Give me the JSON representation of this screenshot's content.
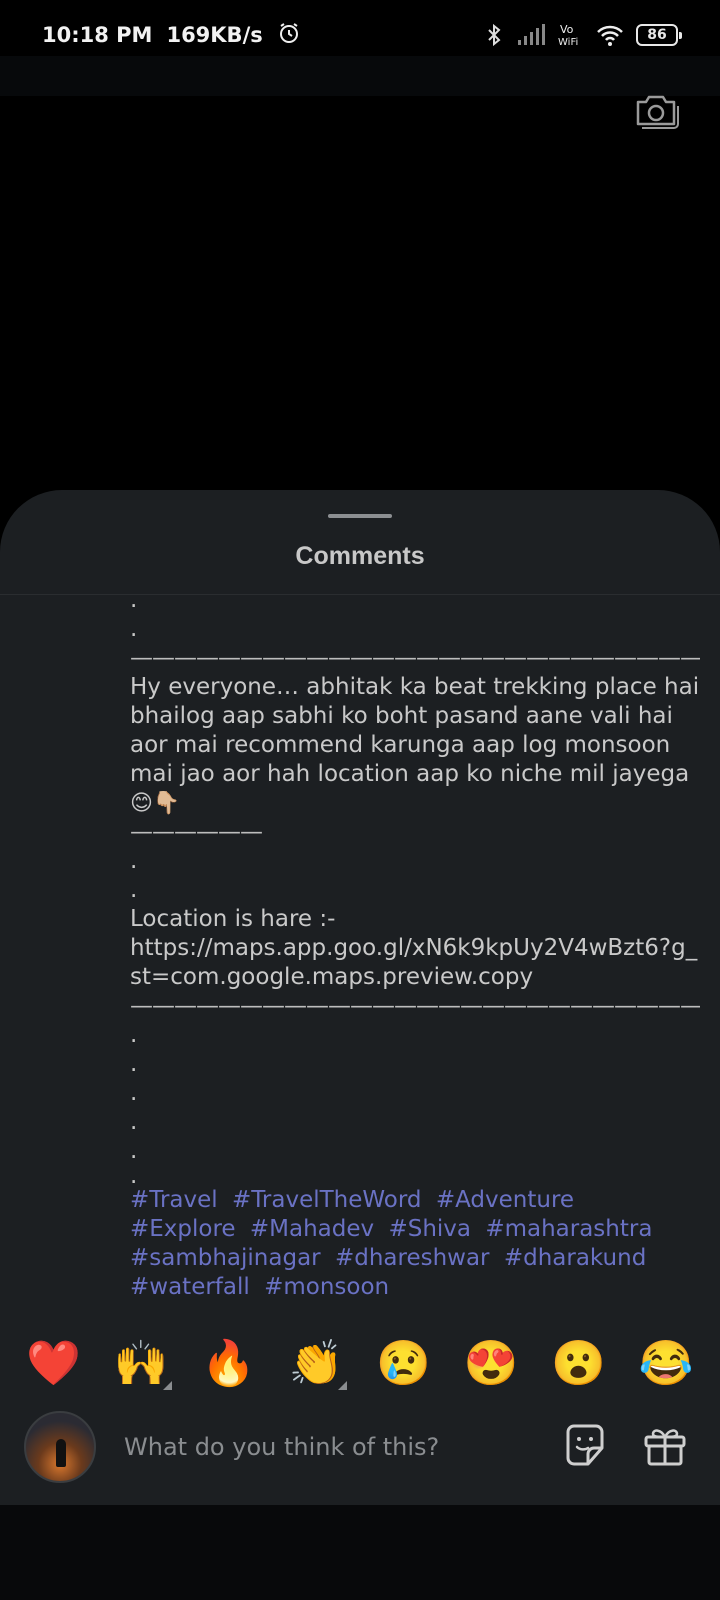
{
  "status_bar": {
    "time": "10:18 PM",
    "net_speed": "169KB/s",
    "icons": [
      "alarm-icon",
      "bluetooth-icon",
      "signal-icon",
      "vowifi-icon",
      "wifi-icon"
    ],
    "vowifi_label": "Vo WiFi",
    "battery": "86"
  },
  "sheet": {
    "title": "Comments"
  },
  "comment": {
    "lines_top": [
      ".",
      "."
    ],
    "rule_long": "——————————————————————————",
    "paragraph": "Hy everyone… abhitak ka beat trekking place hai bhailog aap sabhi ko boht pasand aane vali hai aor mai recommend karunga aap log monsoon mai jao aor hah location aap ko niche mil jayega",
    "paragraph_emoji": "😊👇🏼",
    "rule_short": "——————",
    "lines_mid": [
      ".",
      "."
    ],
    "location_label": "Location is hare :-",
    "location_url": "https://maps.app.goo.gl/xN6k9kpUy2V4wBzt6?g_st=com.google.maps.preview.copy",
    "rule_long_2": "——————————————————————————",
    "lines_bottom": [
      ".",
      ".",
      ".",
      ".",
      ".",
      "."
    ],
    "hashtags": [
      "#Travel",
      "#TravelTheWord",
      "#Adventure",
      "#Explore",
      "#Mahadev",
      "#Shiva",
      "#maharashtra",
      "#sambhajinagar",
      "#dhareshwar",
      "#dharakund",
      "#waterfall",
      "#monsoon"
    ],
    "hashtag_color": "#6a72c4"
  },
  "reactions": [
    "❤️",
    "🙌",
    "🔥",
    "👏",
    "😢",
    "😍",
    "😮",
    "😂"
  ],
  "input": {
    "placeholder": "What do you think of this?"
  }
}
